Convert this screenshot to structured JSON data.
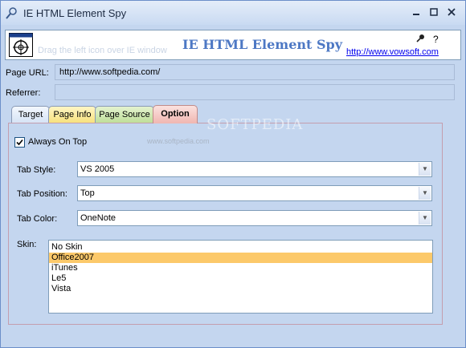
{
  "window": {
    "title": "IE HTML Element Spy"
  },
  "header": {
    "drag_hint": "Drag the left icon over IE window",
    "app_title": "IE HTML Element Spy",
    "url": "http://www.vowsoft.com",
    "help_label": "?"
  },
  "fields": {
    "page_url_label": "Page URL:",
    "page_url_value": "http://www.softpedia.com/",
    "referrer_label": "Referrer:",
    "referrer_value": ""
  },
  "tabs": [
    {
      "label": "Target"
    },
    {
      "label": "Page Info"
    },
    {
      "label": "Page Source"
    },
    {
      "label": "Option"
    }
  ],
  "option": {
    "always_on_top_label": "Always On Top",
    "always_on_top_checked": true,
    "tab_style_label": "Tab Style:",
    "tab_style_value": "VS 2005",
    "tab_position_label": "Tab Position:",
    "tab_position_value": "Top",
    "tab_color_label": "Tab Color:",
    "tab_color_value": "OneNote",
    "skin_label": "Skin:",
    "skins": [
      "No Skin",
      "Office2007",
      "iTunes",
      "Le5",
      "Vista"
    ],
    "selected_skin": "Office2007"
  },
  "watermark": {
    "main": "SOFTPEDIA",
    "sub": "www.softpedia.com"
  },
  "colors": {
    "selected_item": "#fcc96a",
    "accent_title": "#4d78c4",
    "link": "#0000ee"
  }
}
